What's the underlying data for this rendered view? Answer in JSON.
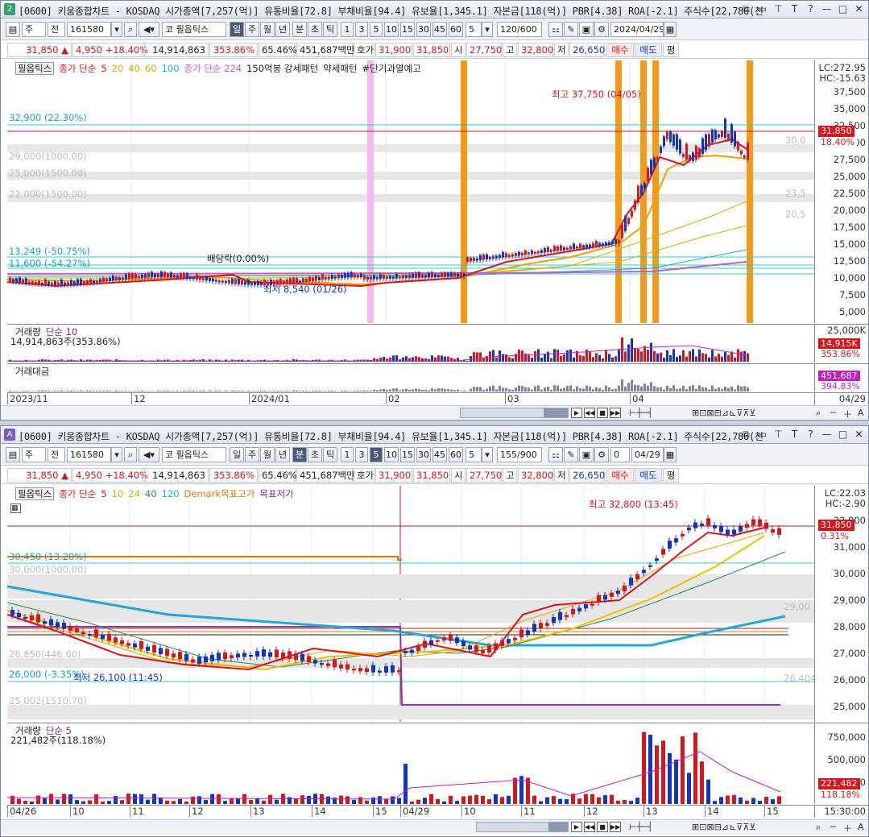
{
  "pane1": {
    "num": "2",
    "num_color": "#35a06e",
    "title": "[0600] 키움종합차트 - KOSDAQ 시가총액[7,257(억)] 유통비율[72.8] 부채비율[94.4] 유보율[1,345.1] 자본금[118(억)] PBR[4.38] ROA[-2.1] 주식수[22,786(천",
    "toolbar": {
      "market": "주",
      "mode": "전",
      "code": "161580",
      "stock_name": "필옵틱스",
      "code_prefix": "코",
      "periods": [
        "일",
        "주",
        "월",
        "년",
        "분",
        "초",
        "틱"
      ],
      "selected_period": "일",
      "intervals": [
        "1",
        "3",
        "5",
        "10",
        "15",
        "30",
        "45",
        "60"
      ],
      "interval_value": "5",
      "count": "120",
      "count_max": "/600",
      "date": "2024/04/29"
    },
    "quote": {
      "price": "31,850",
      "arrow": "▲",
      "change": "4,950",
      "rate": "+18.40%",
      "volume": "14,914,863",
      "vol_rate": "353.86%",
      "turnover": "65.46%",
      "amount": "451,687백만",
      "bid_label": "호가",
      "bid": "31,900",
      "ask": "31,850",
      "open_label": "시",
      "open": "27,750",
      "high_label": "고",
      "high": "32,800",
      "low_label": "저",
      "low": "26,650",
      "buy": "매수",
      "sell": "매도",
      "eval": "평"
    },
    "legend": {
      "name": "필옵틱스",
      "close": "종가 단순",
      "ma5": "5",
      "ma20": "20",
      "ma40": "40",
      "ma60": "60",
      "ma100": "100",
      "ma224": "종가 단순 224",
      "pattern1": "150억봉 강세패턴",
      "pattern2": "약세패턴",
      "pattern3": "#단기과열예고"
    },
    "axis": [
      "37,500",
      "35,000",
      "32,500",
      "30,000",
      "27,500",
      "25,000",
      "22,500",
      "20,000",
      "17,500",
      "15,000",
      "12,500",
      "10,000",
      "7,500",
      "5,000"
    ],
    "lc": "LC:272.95",
    "hc": "HC:-15.63",
    "cur_price": "31,850",
    "cur_rate": "18.40%",
    "levels": [
      {
        "text": "32,900 (22.30%)"
      },
      {
        "text": "29,000(1000.00)"
      },
      {
        "text": "25,000(1500.00)"
      },
      {
        "text": "22,000(1500.00)"
      },
      {
        "text": "13,249 (-50.75%)"
      },
      {
        "text": "11,600 (-54.27%)"
      }
    ],
    "right_marks": [
      "30,0",
      "23,5",
      "20,5"
    ],
    "high_note": "최고 37,750 (04/05)",
    "low_note": "최저 8,540 (01/26)",
    "div_note": "배당락(0.00%)",
    "vol_legend": {
      "name": "거래량",
      "ma": "단순 10",
      "value": "14,914,863주(353.86%)"
    },
    "vol_axis": "25,000K",
    "vol_tag": "14,915K",
    "vol_rate_tag": "353.86%",
    "amt_legend": "거래대금",
    "amt_tag": "451,687",
    "amt_rate": "394.83%",
    "xaxis": [
      "2023/11",
      "12",
      "2024/01",
      "02",
      "03",
      "04"
    ],
    "x_right": "04/29"
  },
  "pane2": {
    "num": "A",
    "num_color": "#7a5cc8",
    "title": "[0600] 키움종합차트 - KOSDAQ 시가총액[7,257(억)] 유통비율[72.8] 부채비율[94.4] 유보율[1,345.1] 자본금[118(억)] PBR[4.38] ROA[-2.1] 주식수[22,786(천",
    "toolbar": {
      "market": "주",
      "mode": "전",
      "code": "161580",
      "stock_name": "필옵틱스",
      "code_prefix": "코",
      "periods": [
        "일",
        "주",
        "월",
        "년",
        "분",
        "초",
        "틱"
      ],
      "selected_period": "분",
      "intervals": [
        "1",
        "3",
        "5",
        "10",
        "15",
        "30",
        "45",
        "60"
      ],
      "interval_value": "5",
      "count": "155",
      "count_max": "/900",
      "date": "04/29",
      "check": "0"
    },
    "legend": {
      "name": "필옵틱스",
      "close": "종가 단순",
      "ma5": "5",
      "ma10": "10",
      "ma24": "24",
      "ma40": "40",
      "ma120": "120",
      "demark_hi": "Demark목표고가",
      "demark_lo": "목표저가"
    },
    "axis": [
      "32,000",
      "31,000",
      "30,000",
      "29,000",
      "28,000",
      "27,000",
      "26,000",
      "25,000"
    ],
    "lc": "LC:22.03",
    "hc": "HC:-2.90",
    "cur_price": "31,850",
    "cur_rate": "0.31%",
    "levels": [
      {
        "text": "30,450 (13.20%)"
      },
      {
        "text": "30,000(1000.00)"
      },
      {
        "text": "26,850(446.60)"
      },
      {
        "text": "26,000 (-3.35%)"
      },
      {
        "text": "25,002(1510.70)"
      }
    ],
    "right_marks": [
      "29,00",
      "26,404"
    ],
    "high_note": "최고 32,800 (13:45)",
    "low_note": "최저 26,100 (11:45)",
    "vol_legend": {
      "name": "거래량",
      "ma": "단순 5",
      "value": "221,482주(118.18%)"
    },
    "vol_axis": [
      "750,000",
      "500,000",
      "250,000"
    ],
    "vol_tag": "221,482",
    "vol_rate_tag": "118.18%",
    "xaxis": [
      "04/26",
      "10",
      "11",
      "12",
      "13",
      "14",
      "15",
      "04/29",
      "10",
      "11",
      "12",
      "13",
      "14",
      "15"
    ],
    "x_right": "15:30:00"
  }
}
